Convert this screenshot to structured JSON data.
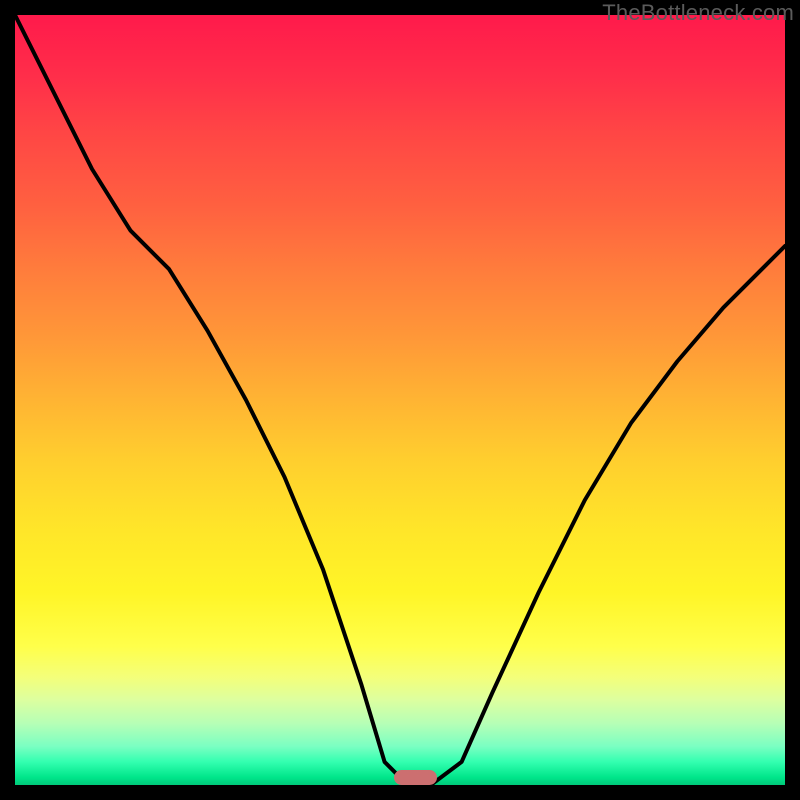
{
  "watermark": "TheBottleneck.com",
  "colors": {
    "curve": "#000000",
    "marker": "#cc6f70",
    "frame": "#000000"
  },
  "chart_data": {
    "type": "line",
    "title": "",
    "xlabel": "",
    "ylabel": "",
    "xlim": [
      0,
      100
    ],
    "ylim": [
      0,
      100
    ],
    "grid": false,
    "legend": false,
    "series": [
      {
        "name": "bottleneck-curve",
        "x": [
          0,
          5,
          10,
          15,
          20,
          25,
          30,
          35,
          40,
          45,
          48,
          51,
          54,
          58,
          62,
          68,
          74,
          80,
          86,
          92,
          100
        ],
        "values": [
          100,
          90,
          80,
          72,
          67,
          59,
          50,
          40,
          28,
          13,
          3,
          0,
          0,
          3,
          12,
          25,
          37,
          47,
          55,
          62,
          70
        ]
      }
    ],
    "marker": {
      "x": 52,
      "y": 0,
      "width_pct": 5.5
    },
    "background_gradient": {
      "top": "#ff1a4b",
      "mid": "#ffe629",
      "bottom": "#00c97a"
    }
  }
}
